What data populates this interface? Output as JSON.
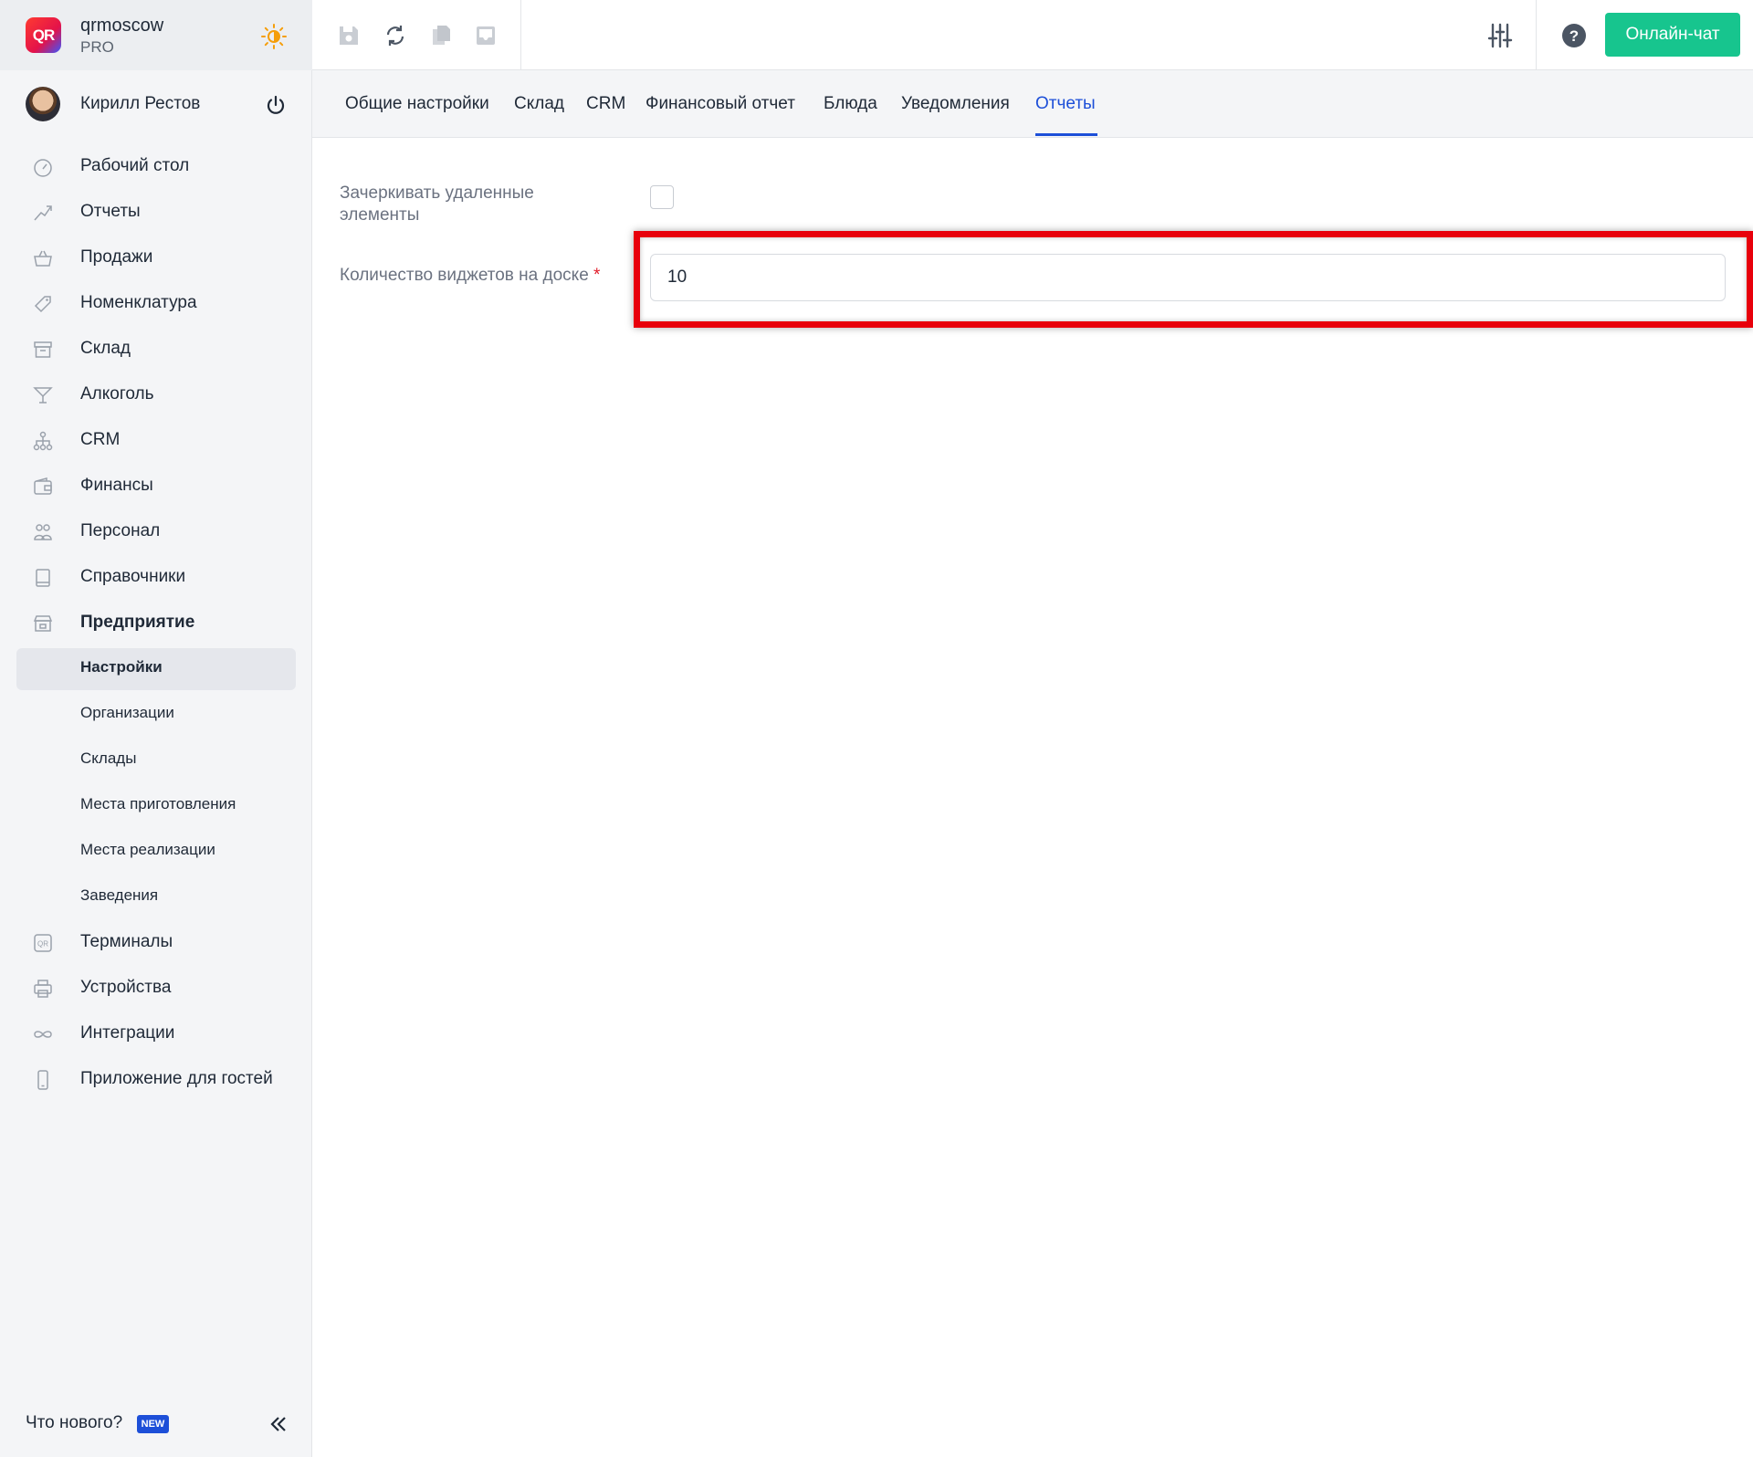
{
  "brand": {
    "name": "qrmoscow",
    "plan": "PRO",
    "logo_text": "QR"
  },
  "user": {
    "name": "Кирилл Рестов"
  },
  "nav": [
    {
      "label": "Рабочий стол",
      "icon": "dashboard-gauge-icon"
    },
    {
      "label": "Отчеты",
      "icon": "chart-trend-icon"
    },
    {
      "label": "Продажи",
      "icon": "basket-icon"
    },
    {
      "label": "Номенклатура",
      "icon": "tag-icon"
    },
    {
      "label": "Склад",
      "icon": "archive-box-icon"
    },
    {
      "label": "Алкоголь",
      "icon": "cocktail-glass-icon"
    },
    {
      "label": "CRM",
      "icon": "org-chart-icon"
    },
    {
      "label": "Финансы",
      "icon": "wallet-icon"
    },
    {
      "label": "Персонал",
      "icon": "people-icon"
    },
    {
      "label": "Справочники",
      "icon": "book-icon"
    },
    {
      "label": "Предприятие",
      "icon": "store-icon"
    }
  ],
  "subnav": [
    {
      "label": "Настройки",
      "active": true
    },
    {
      "label": "Организации"
    },
    {
      "label": "Склады"
    },
    {
      "label": "Места приготовления"
    },
    {
      "label": "Места реализации"
    },
    {
      "label": "Заведения"
    }
  ],
  "nav_bottom": [
    {
      "label": "Терминалы",
      "icon": "qr-terminal-icon"
    },
    {
      "label": "Устройства",
      "icon": "printer-icon"
    },
    {
      "label": "Интеграции",
      "icon": "infinity-icon"
    },
    {
      "label": "Приложение для гостей",
      "icon": "phone-icon"
    }
  ],
  "footer": {
    "whats_new": "Что нового?",
    "badge": "NEW"
  },
  "topbar": {
    "chat_label": "Онлайн-чат"
  },
  "tabs": [
    {
      "label": "Общие настройки"
    },
    {
      "label": "Склад"
    },
    {
      "label": "CRM"
    },
    {
      "label": "Финансовый отчет"
    },
    {
      "label": "Блюда"
    },
    {
      "label": "Уведомления"
    },
    {
      "label": "Отчеты",
      "active": true
    }
  ],
  "form": {
    "strike_deleted_label_line1": "Зачеркивать удаленные",
    "strike_deleted_label_line2": "элементы",
    "strike_deleted_checked": false,
    "widgets_label": "Количество виджетов на доске",
    "widgets_required_mark": "*",
    "widgets_value": "10"
  },
  "colors": {
    "accent": "#1d4fd8",
    "chat_button": "#17c58e",
    "highlight": "#e8000b"
  }
}
